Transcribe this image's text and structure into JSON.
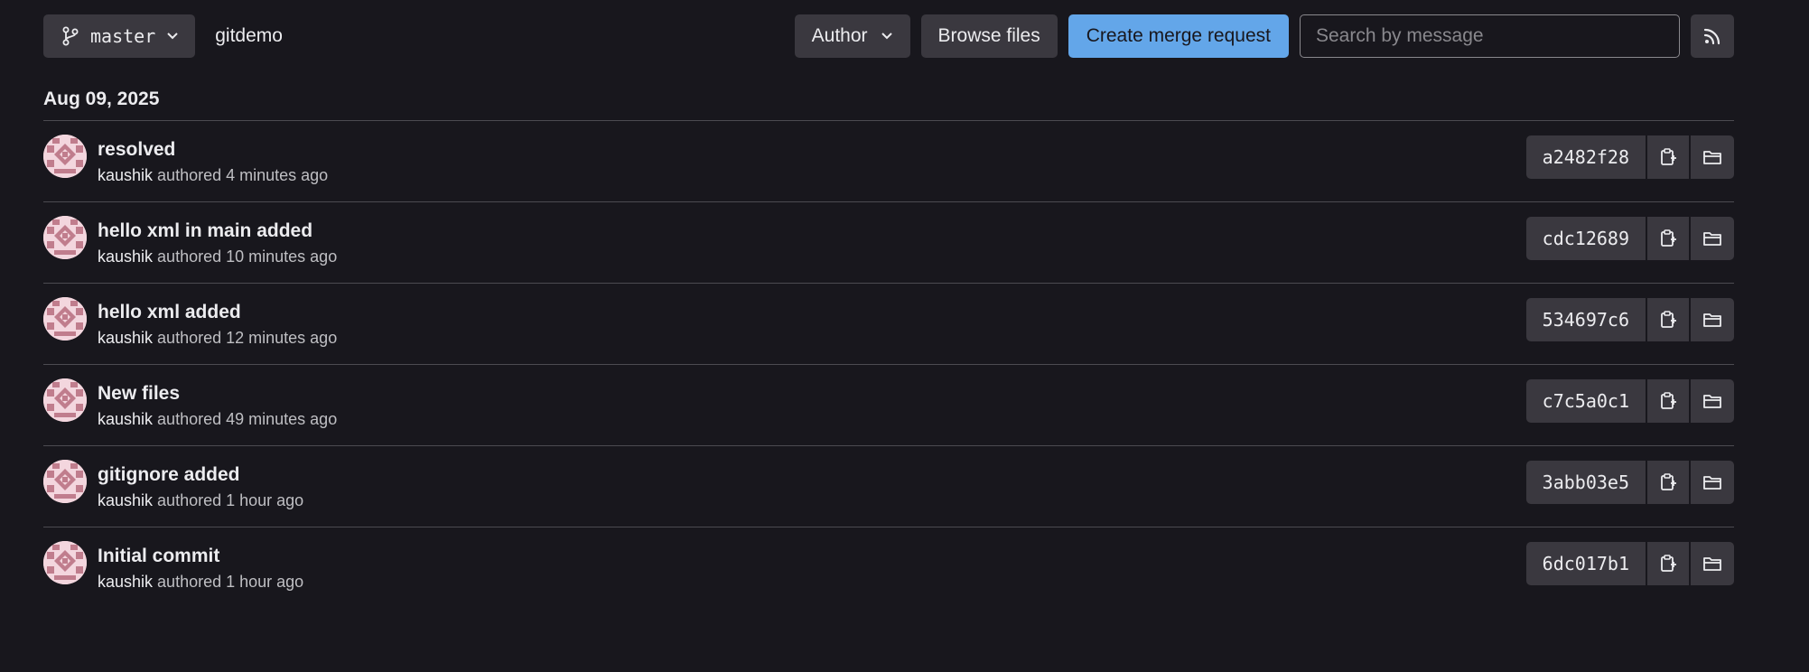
{
  "toolbar": {
    "branch": "master",
    "project": "gitdemo",
    "author_label": "Author",
    "browse_label": "Browse files",
    "create_mr_label": "Create merge request",
    "search_placeholder": "Search by message"
  },
  "date": "Aug 09, 2025",
  "commits": [
    {
      "title": "resolved",
      "author": "kaushik",
      "authored": "authored",
      "time": "4 minutes ago",
      "sha": "a2482f28"
    },
    {
      "title": "hello xml in main added",
      "author": "kaushik",
      "authored": "authored",
      "time": "10 minutes ago",
      "sha": "cdc12689"
    },
    {
      "title": "hello xml added",
      "author": "kaushik",
      "authored": "authored",
      "time": "12 minutes ago",
      "sha": "534697c6"
    },
    {
      "title": "New files",
      "author": "kaushik",
      "authored": "authored",
      "time": "49 minutes ago",
      "sha": "c7c5a0c1"
    },
    {
      "title": "gitignore added",
      "author": "kaushik",
      "authored": "authored",
      "time": "1 hour ago",
      "sha": "3abb03e5"
    },
    {
      "title": "Initial commit",
      "author": "kaushik",
      "authored": "authored",
      "time": "1 hour ago",
      "sha": "6dc017b1"
    }
  ],
  "icons": {
    "branch": "branch-icon",
    "chevron": "chevron-down-icon",
    "rss": "rss-icon",
    "copy": "copy-to-clipboard-icon",
    "folder": "folder-icon"
  },
  "colors": {
    "background": "#18171d",
    "button": "#3a383f",
    "primary": "#63a6e9",
    "divider": "#4c4b51",
    "avatar": "#c07d8d"
  }
}
